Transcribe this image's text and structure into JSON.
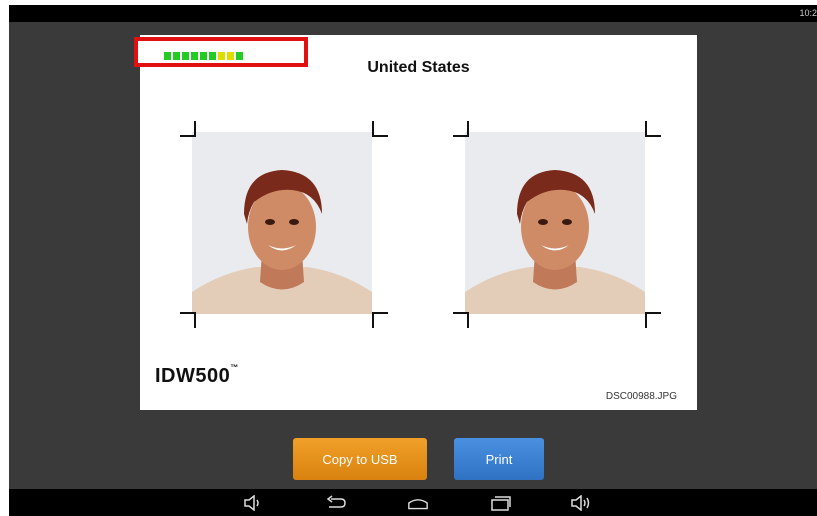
{
  "statusbar": {
    "clock": "10:2"
  },
  "quality_meter": {
    "segments": [
      "#22cc22",
      "#22cc22",
      "#22cc22",
      "#22cc22",
      "#22cc22",
      "#22cc22",
      "#dddd00",
      "#dddd00",
      "#22cc22"
    ]
  },
  "preview": {
    "country": "United States",
    "brand": "IDW500",
    "trademark": "™",
    "filename": "DSC00988.JPG"
  },
  "actions": {
    "copy_label": "Copy to USB",
    "print_label": "Print"
  },
  "navbar": {
    "icons": [
      "volume-down-icon",
      "back-icon",
      "home-icon",
      "recent-apps-icon",
      "volume-up-icon"
    ]
  },
  "colors": {
    "copy_button": "#e8951c",
    "print_button": "#3b82d2",
    "quality_border": "#e21010"
  }
}
